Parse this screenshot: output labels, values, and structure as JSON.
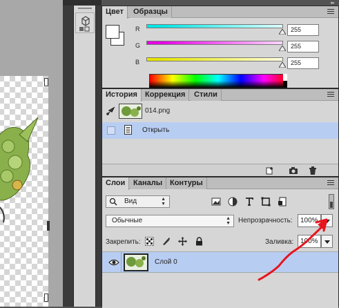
{
  "color_panel": {
    "tabs": [
      "Цвет",
      "Образцы"
    ],
    "channels": [
      {
        "label": "R",
        "value": "255",
        "color": "#00e5e5"
      },
      {
        "label": "G",
        "value": "255",
        "color": "#e500e5"
      },
      {
        "label": "B",
        "value": "255",
        "color": "#e5e500"
      }
    ],
    "foreground": "#ffffff",
    "background": "#ffffff"
  },
  "history_panel": {
    "tabs": [
      "История",
      "Коррекция",
      "Стили"
    ],
    "snapshot_label": "014.png",
    "open_label": "Открыть",
    "selected_row_color": "#b8cdf2"
  },
  "layers_panel": {
    "tabs": [
      "Слои",
      "Каналы",
      "Контуры"
    ],
    "filter_label": "Вид",
    "blend_mode": "Обычные",
    "opacity_label": "Непрозрачность:",
    "opacity_value": "100%",
    "lock_label": "Закрепить:",
    "fill_label": "Заливка:",
    "fill_value": "100%",
    "layer_name": "Слой 0"
  },
  "annotation_color": "#e8141e"
}
